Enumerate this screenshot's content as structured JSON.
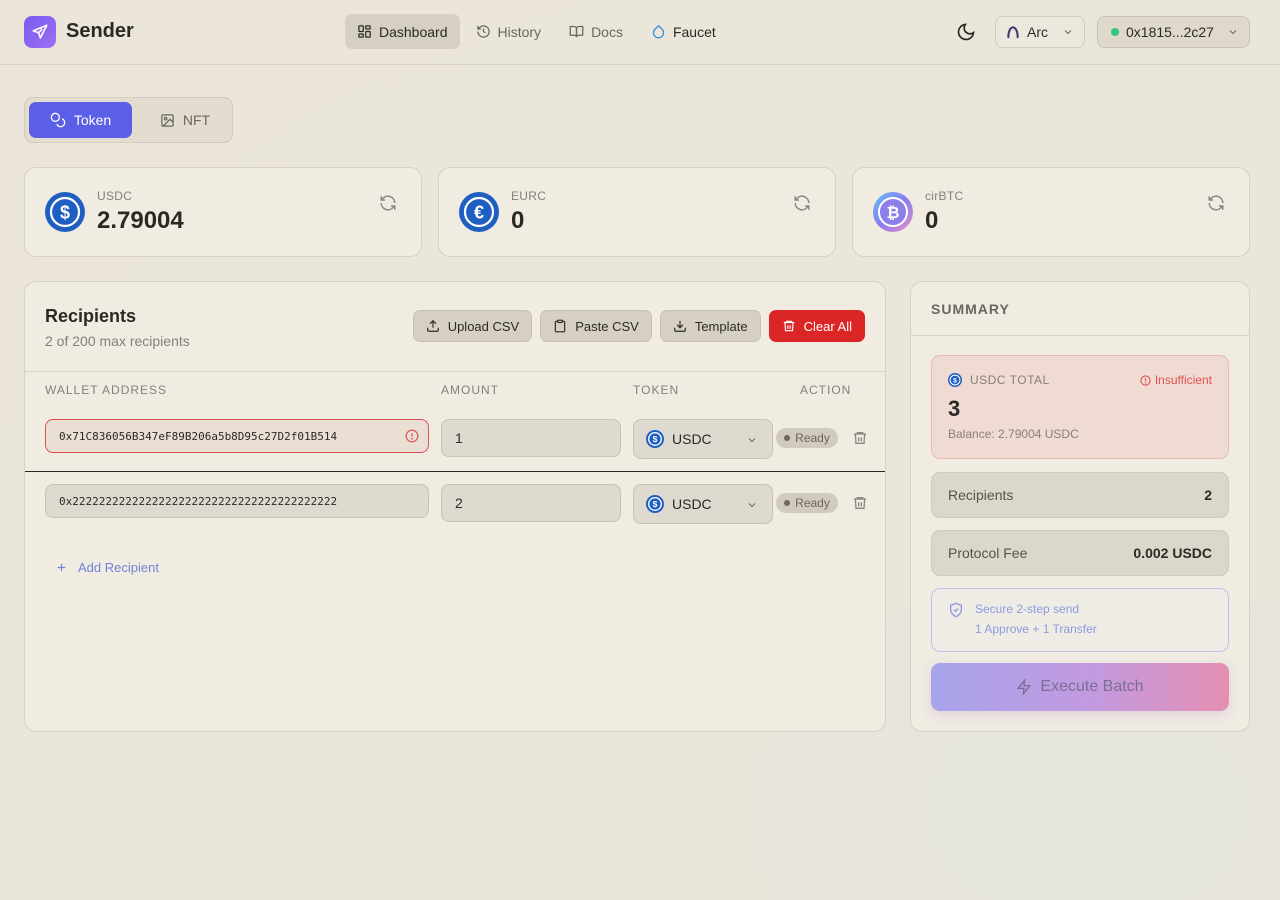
{
  "app": {
    "name": "Sender"
  },
  "nav": {
    "items": [
      {
        "label": "Dashboard",
        "icon": "grid-icon",
        "active": true
      },
      {
        "label": "History",
        "icon": "history-icon",
        "active": false
      },
      {
        "label": "Docs",
        "icon": "book-icon",
        "active": false
      },
      {
        "label": "Faucet",
        "icon": "droplet-icon",
        "active": false
      }
    ]
  },
  "header": {
    "chain": "Arc",
    "wallet": "0x1815...2c27"
  },
  "asset_toggle": {
    "token": "Token",
    "nft": "NFT"
  },
  "balances": [
    {
      "symbol": "USDC",
      "value": "2.79004",
      "icon": "usdc-icon"
    },
    {
      "symbol": "EURC",
      "value": "0",
      "icon": "eurc-icon"
    },
    {
      "symbol": "cirBTC",
      "value": "0",
      "icon": "btc-icon"
    }
  ],
  "recipients": {
    "title": "Recipients",
    "subtitle": "2 of 200 max recipients",
    "actions": {
      "upload": "Upload CSV",
      "paste": "Paste CSV",
      "template": "Template",
      "clear": "Clear All"
    },
    "columns": {
      "address": "WALLET ADDRESS",
      "amount": "AMOUNT",
      "token": "TOKEN",
      "action": "ACTION"
    },
    "rows": [
      {
        "address": "0x71C836056B347eF89B206a5b8D95c27D2f01B514",
        "amount": "1",
        "token": "USDC",
        "status": "Ready",
        "error": true
      },
      {
        "address": "0x2222222222222222222222222222222222222222",
        "amount": "2",
        "token": "USDC",
        "status": "Ready",
        "error": false
      }
    ],
    "add_label": "Add Recipient"
  },
  "summary": {
    "title": "SUMMARY",
    "total_label": "USDC TOTAL",
    "insufficient": "Insufficient",
    "total_value": "3",
    "balance_text": "Balance: 2.79004 USDC",
    "recipients_label": "Recipients",
    "recipients_value": "2",
    "fee_label": "Protocol Fee",
    "fee_value": "0.002 USDC",
    "secure_title": "Secure 2-step send",
    "secure_sub": "1 Approve + 1 Transfer",
    "execute": "Execute Batch"
  },
  "colors": {
    "accent": "#5b5ee6",
    "danger": "#dc2626",
    "success_dot": "#34c77b",
    "usdc": "#2775ca"
  }
}
